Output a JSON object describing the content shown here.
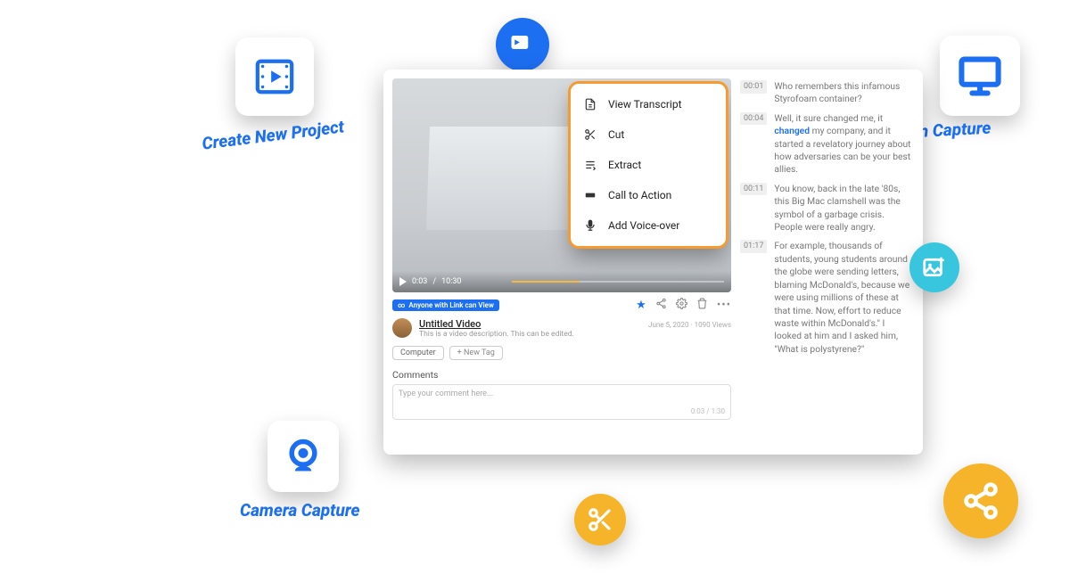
{
  "floaters": {
    "create": "Create New Project",
    "screen": "Screen Capture",
    "camera": "Camera Capture"
  },
  "menu": {
    "view": "View Transcript",
    "cut": "Cut",
    "extract": "Extract",
    "cta": "Call to Action",
    "voice": "Add Voice-over"
  },
  "playbar": {
    "current": "0:03",
    "total": "10:30"
  },
  "share_pill": {
    "prefix": "∞",
    "text": "Anyone with Link can View"
  },
  "title": "Untitled Video",
  "meta": "June 5, 2020 · 1090 Views",
  "desc": "This is a video description. This can be edited.",
  "tags": {
    "t1": "Computer",
    "add": "+ New Tag"
  },
  "comments_h": "Comments",
  "comment_ph": "Type your comment here...",
  "comment_tag": "0:03 / 1:30",
  "transcript": {
    "r1": {
      "t": "00:01",
      "txt": "Who remembers this infamous Styrofoam container?"
    },
    "r2": {
      "t": "00:04",
      "pre": "Well, it sure changed me, it ",
      "hl": "changed",
      "post": " my company, and it started a revelatory journey about how adversaries can be your best allies."
    },
    "r3": {
      "t": "00:11",
      "txt": "You know, back in the late '80s, this Big Mac clamshell was the symbol of a garbage crisis. People were really angry."
    },
    "r4": {
      "t": "01:17",
      "txt": "For example, thousands of students, young students around the globe were sending letters, blaming McDonald's, because we were using millions of these at that time. Now, effort to reduce waste within McDonald's.\" I looked at him and I asked him, \"What is polystyrene?\""
    }
  }
}
